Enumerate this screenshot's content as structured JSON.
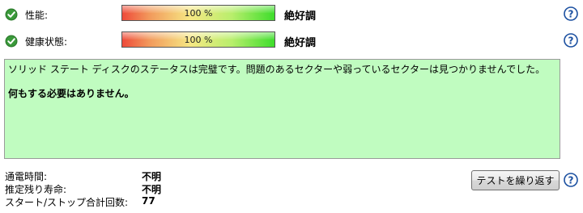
{
  "metrics": [
    {
      "label": "性能:",
      "percent": 100,
      "percent_text": "100 %",
      "status": "絶好調"
    },
    {
      "label": "健康状態:",
      "percent": 100,
      "percent_text": "100 %",
      "status": "絶好調"
    }
  ],
  "message": {
    "line1": "ソリッド ステート ディスクのステータスは完璧です。問題のあるセクターや弱っているセクターは見つかりませんでした。",
    "line2": "何もする必要はありません。"
  },
  "info": [
    {
      "label": "通電時間:",
      "value": "不明"
    },
    {
      "label": "推定残り寿命:",
      "value": "不明"
    },
    {
      "label": "スタート/ストップ合計回数:",
      "value": "77"
    }
  ],
  "buttons": {
    "retest_label": "テストを繰り返す"
  },
  "colors": {
    "ok_green": "#2e8b2e",
    "message_bg": "#c0fcc0",
    "help_blue": "#1a4fa0"
  },
  "icons": {
    "status": "check-icon",
    "help": "help-icon"
  }
}
